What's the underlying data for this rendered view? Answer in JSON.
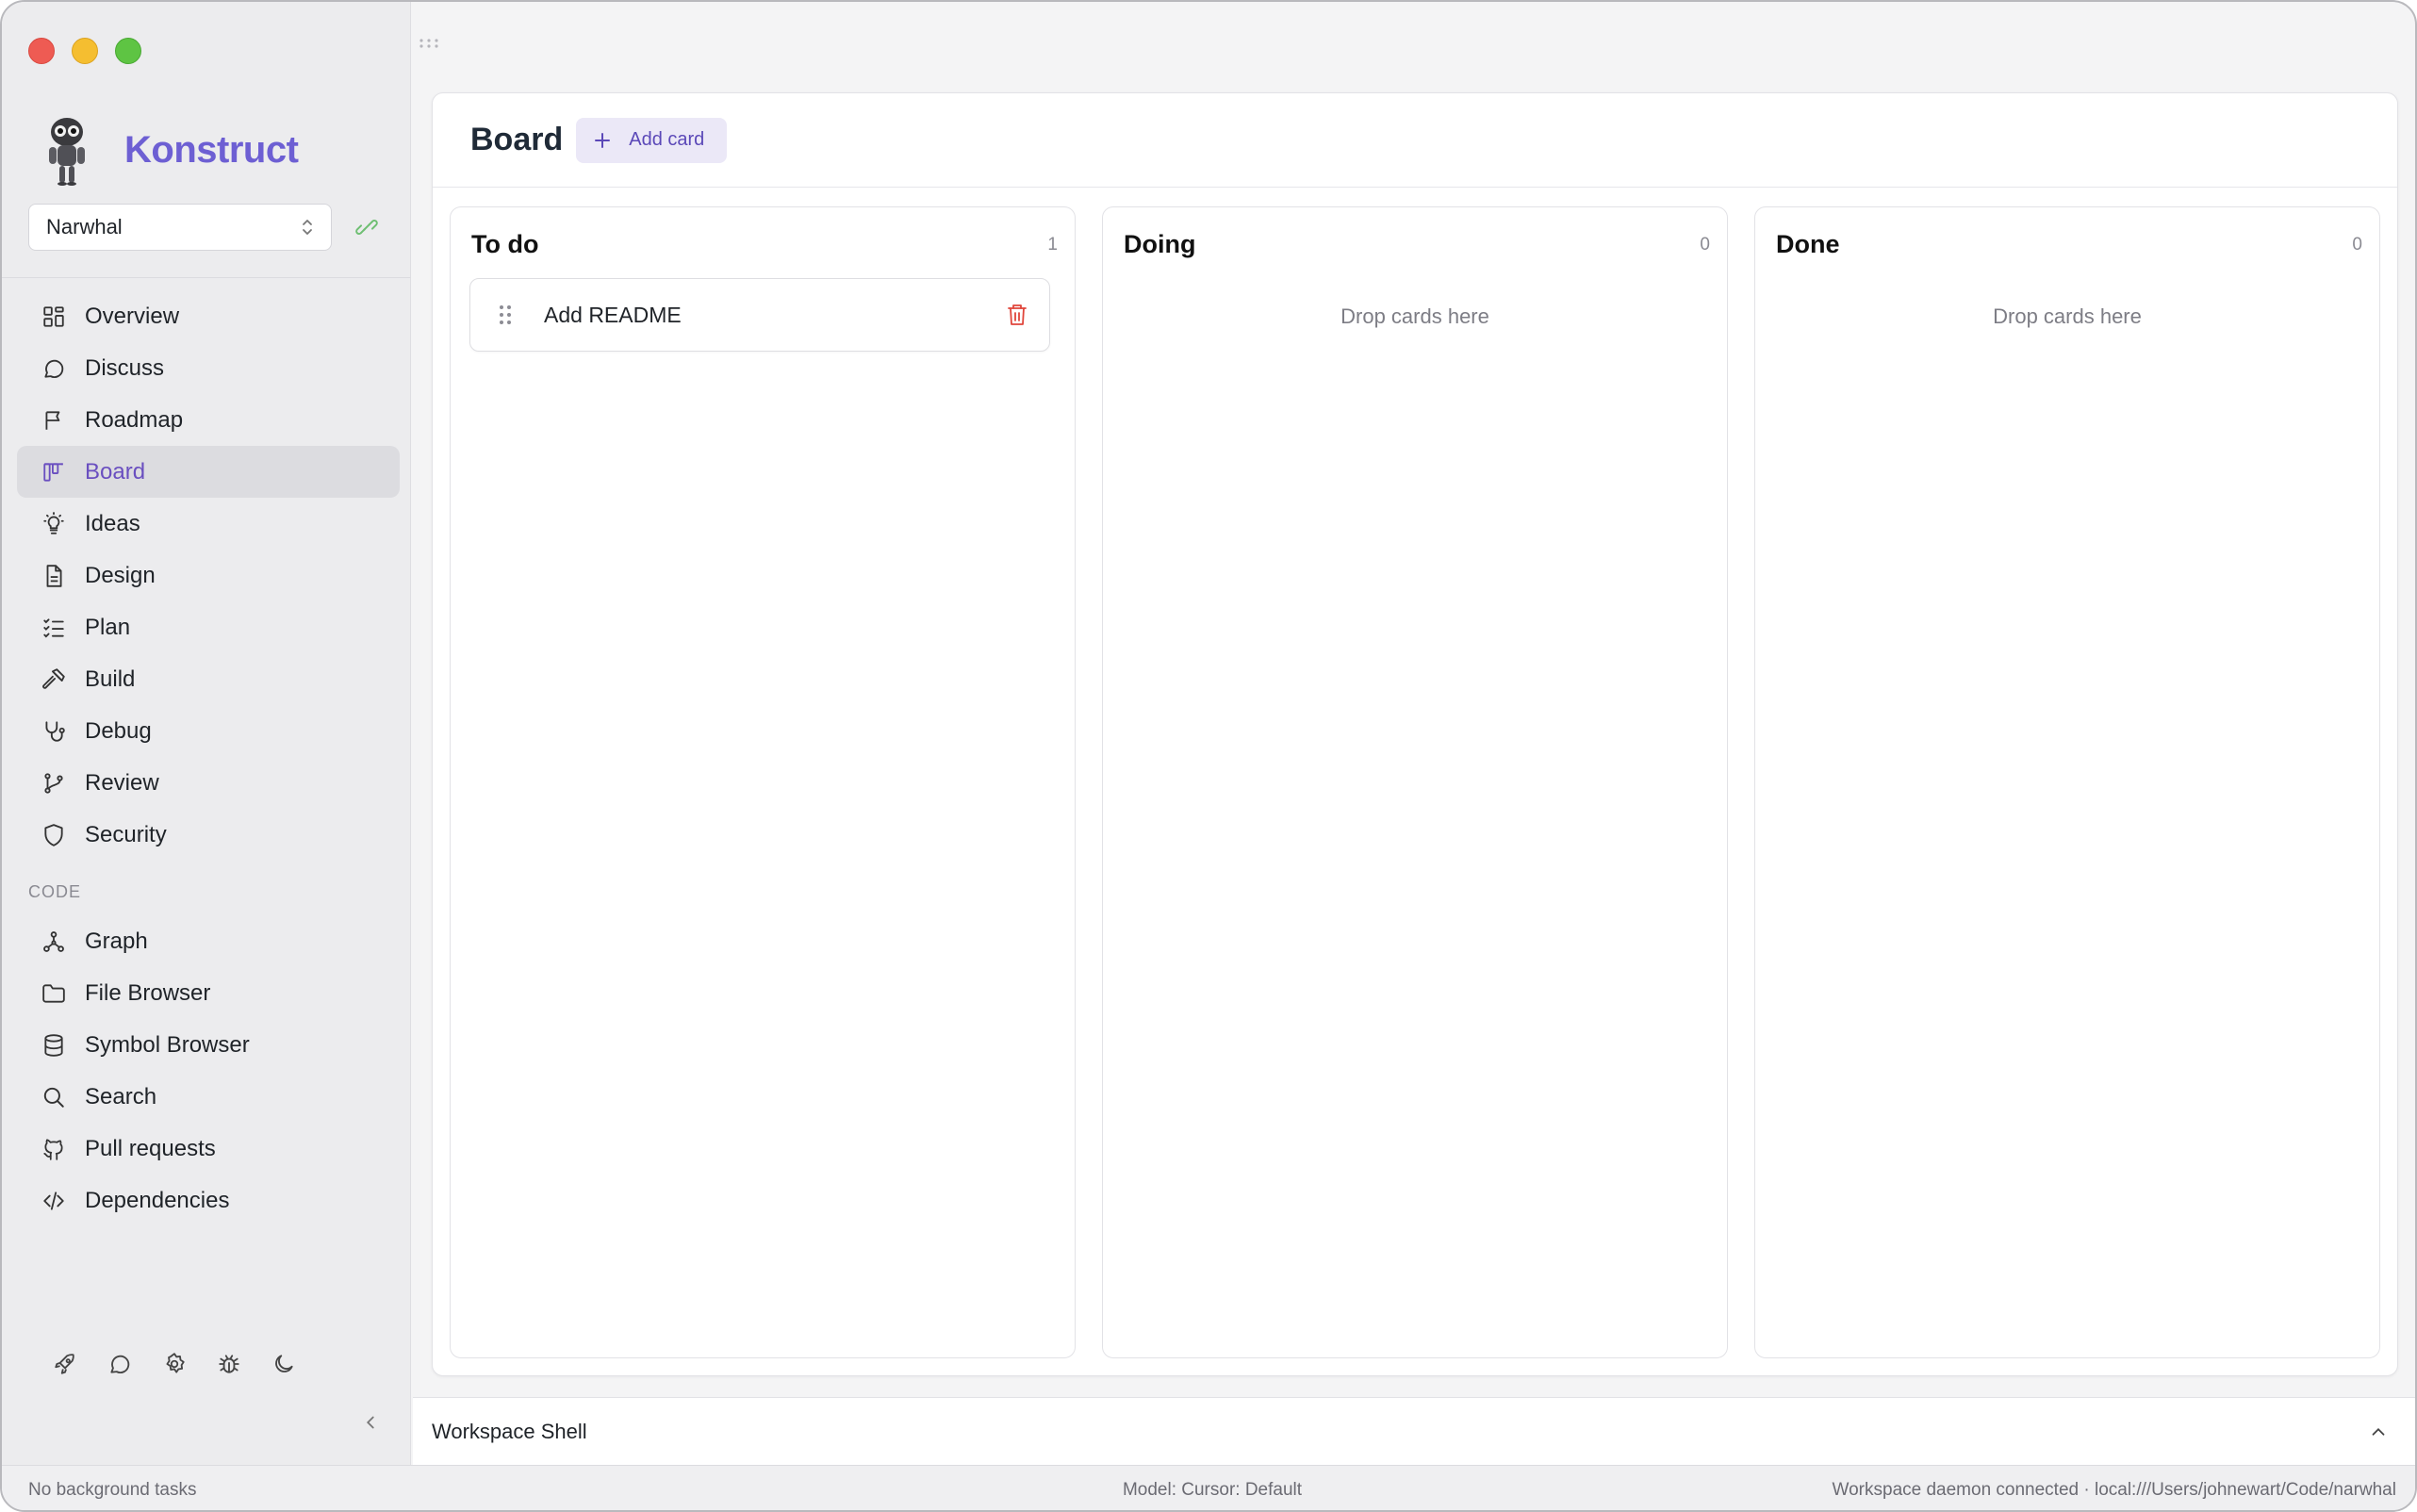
{
  "window": {
    "traffic_lights": [
      "close",
      "minimize",
      "maximize"
    ]
  },
  "sidebar": {
    "brand": {
      "name": "Konstruct",
      "logo": "robot-mascot-icon",
      "color": "#6d5fd3"
    },
    "project_select": {
      "value": "Narwhal"
    },
    "items": [
      {
        "label": "Overview",
        "icon": "grid-icon"
      },
      {
        "label": "Discuss",
        "icon": "chat-bubble-icon"
      },
      {
        "label": "Roadmap",
        "icon": "flag-icon"
      },
      {
        "label": "Board",
        "icon": "kanban-icon",
        "active": true
      },
      {
        "label": "Ideas",
        "icon": "lightbulb-icon"
      },
      {
        "label": "Design",
        "icon": "document-icon"
      },
      {
        "label": "Plan",
        "icon": "checklist-icon"
      },
      {
        "label": "Build",
        "icon": "hammer-icon"
      },
      {
        "label": "Debug",
        "icon": "stethoscope-icon"
      },
      {
        "label": "Review",
        "icon": "git-branch-icon"
      },
      {
        "label": "Security",
        "icon": "shield-icon"
      }
    ],
    "code_section": {
      "heading": "CODE",
      "items": [
        {
          "label": "Graph",
          "icon": "graph-nodes-icon"
        },
        {
          "label": "File Browser",
          "icon": "folder-icon"
        },
        {
          "label": "Symbol Browser",
          "icon": "database-icon"
        },
        {
          "label": "Search",
          "icon": "search-icon"
        },
        {
          "label": "Pull requests",
          "icon": "github-icon"
        },
        {
          "label": "Dependencies",
          "icon": "code-brackets-icon"
        }
      ]
    },
    "bottom_icons": [
      "rocket-icon",
      "chat-icon",
      "settings-gear-icon",
      "bug-icon",
      "moon-icon"
    ]
  },
  "main": {
    "title": "Board",
    "add_card_label": "Add card",
    "accent": "#5b48b8",
    "columns": [
      {
        "title": "To do",
        "count": "1",
        "cards": [
          {
            "title": "Add README"
          }
        ]
      },
      {
        "title": "Doing",
        "count": "0",
        "empty_text": "Drop cards here"
      },
      {
        "title": "Done",
        "count": "0",
        "empty_text": "Drop cards here"
      }
    ]
  },
  "shell": {
    "title": "Workspace Shell"
  },
  "status": {
    "left": "No background tasks",
    "model": "Model: Cursor: Default",
    "daemon": "Workspace daemon connected · local:///Users/johnewart/Code/narwhal"
  }
}
